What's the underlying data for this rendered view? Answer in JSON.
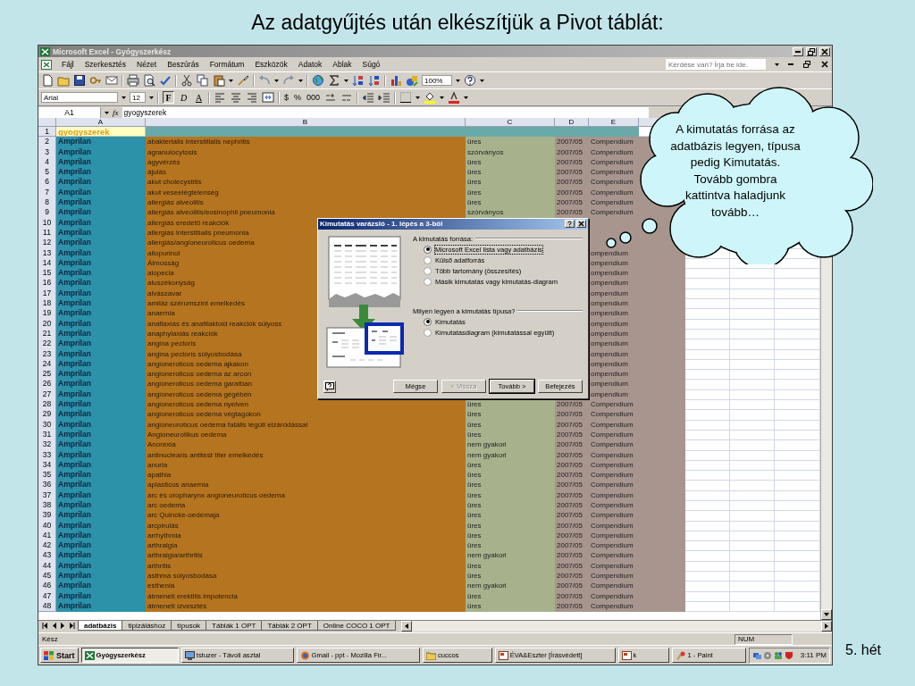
{
  "slide": {
    "title": "Az adatgyűjtés után elkészítjük a Pivot táblát:",
    "footer": "5. hét"
  },
  "window": {
    "title": "Microsoft Excel - Gyógyszerkész"
  },
  "menu": [
    "Fájl",
    "Szerkesztés",
    "Nézet",
    "Beszúrás",
    "Formátum",
    "Eszközök",
    "Adatok",
    "Ablak",
    "Súgó"
  ],
  "help_box": {
    "placeholder": "Kérdése van? Írja be ide."
  },
  "toolbar": {
    "zoom": "100%",
    "font": "Arial",
    "font_size": "12",
    "format_buttons": [
      {
        "label": "F",
        "kind": "bold"
      },
      {
        "label": "D",
        "kind": "italic"
      },
      {
        "label": "A",
        "kind": "underline"
      }
    ],
    "number_buttons": [
      "$",
      "%",
      "000"
    ]
  },
  "formula_bar": {
    "name_box": "A1",
    "function_label": "fx",
    "value": "gyogyszerek"
  },
  "sheet": {
    "columns": [
      "A",
      "B",
      "C",
      "D",
      "E"
    ],
    "rows": [
      {
        "kind": "header",
        "n": "1",
        "a": "gyogyszerek"
      },
      {
        "kind": "data",
        "n": "2",
        "a": "Amprilan",
        "b": "abakterialis interstitialis nephritis",
        "c": "üres",
        "d": "2007/05",
        "e": "Compendium"
      },
      {
        "kind": "data",
        "n": "3",
        "a": "Amprilan",
        "b": "agranulocytosis",
        "c": "szórványos",
        "d": "2007/05",
        "e": "Compendium"
      },
      {
        "kind": "data",
        "n": "4",
        "a": "Amprilan",
        "b": "agyvérzés",
        "c": "üres",
        "d": "2007/05",
        "e": "Compendium"
      },
      {
        "kind": "data",
        "n": "5",
        "a": "Amprilan",
        "b": "ájulás",
        "c": "üres",
        "d": "2007/05",
        "e": "Compendium"
      },
      {
        "kind": "data",
        "n": "6",
        "a": "Amprilan",
        "b": "akut cholecystitis",
        "c": "üres",
        "d": "2007/05",
        "e": "Compendium"
      },
      {
        "kind": "data",
        "n": "7",
        "a": "Amprilan",
        "b": "akut veseelégtelenség",
        "c": "üres",
        "d": "2007/05",
        "e": "Compendium"
      },
      {
        "kind": "data",
        "n": "8",
        "a": "Amprilan",
        "b": "allergiás alveolitis",
        "c": "üres",
        "d": "2007/05",
        "e": "Compendium"
      },
      {
        "kind": "data",
        "n": "9",
        "a": "Amprilan",
        "b": "allergiás alveolitis/eosinophil pneumonia",
        "c": "szórványos",
        "d": "2007/05",
        "e": "Compendium"
      },
      {
        "kind": "data",
        "n": "10",
        "a": "Amprilan",
        "b": "allergiás eredetű reakciók"
      },
      {
        "kind": "data",
        "n": "11",
        "a": "Amprilan",
        "b": "allergiás interstitialis pneumonia"
      },
      {
        "kind": "data",
        "n": "12",
        "a": "Amprilan",
        "b": "allergiás/angioneuroticus oedema"
      },
      {
        "kind": "data",
        "n": "13",
        "a": "Amprilan",
        "b": "allopurinol",
        "e": "ompendium"
      },
      {
        "kind": "data",
        "n": "14",
        "a": "Amprilan",
        "b": "Álmosság",
        "e": "ompendium"
      },
      {
        "kind": "data",
        "n": "15",
        "a": "Amprilan",
        "b": "alopecia",
        "e": "ompendium"
      },
      {
        "kind": "data",
        "n": "16",
        "a": "Amprilan",
        "b": "aluszékonyság",
        "e": "ompendium"
      },
      {
        "kind": "data",
        "n": "17",
        "a": "Amprilan",
        "b": "alvászavar",
        "e": "ompendium"
      },
      {
        "kind": "data",
        "n": "18",
        "a": "Amprilan",
        "b": "amiláz szérumszint emelkedés",
        "e": "ompendium"
      },
      {
        "kind": "data",
        "n": "19",
        "a": "Amprilan",
        "b": "anaemia",
        "e": "ompendium"
      },
      {
        "kind": "data",
        "n": "20",
        "a": "Amprilan",
        "b": "anafiaxiás és anafilaktoid reakciók súlyoss",
        "e": "ompendium"
      },
      {
        "kind": "data",
        "n": "21",
        "a": "Amprilan",
        "b": "anaphylaxiás reakciók",
        "e": "ompendium"
      },
      {
        "kind": "data",
        "n": "22",
        "a": "Amprilan",
        "b": "angina pectoris",
        "e": "ompendium"
      },
      {
        "kind": "data",
        "n": "23",
        "a": "Amprilan",
        "b": "angina pectoris súlyosbodása",
        "e": "ompendium"
      },
      {
        "kind": "data",
        "n": "24",
        "a": "Amprilan",
        "b": "angioneroticus oedema ajkakon",
        "e": "ompendium"
      },
      {
        "kind": "data",
        "n": "25",
        "a": "Amprilan",
        "b": "angioneroticus oedema az arcon",
        "e": "ompendium"
      },
      {
        "kind": "data",
        "n": "26",
        "a": "Amprilan",
        "b": "angioneroticus oedema garatban",
        "e": "ompendium"
      },
      {
        "kind": "data",
        "n": "27",
        "a": "Amprilan",
        "b": "angioneroticus oedema gégében",
        "e": "ompendium"
      },
      {
        "kind": "data",
        "n": "28",
        "a": "Amprilan",
        "b": "angioneroticus oedema nyelven",
        "c": "üres",
        "d": "2007/05",
        "e": "Compendium"
      },
      {
        "kind": "data",
        "n": "29",
        "a": "Amprilan",
        "b": "angioneroticus oedema végtagokon",
        "c": "üres",
        "d": "2007/05",
        "e": "Compendium"
      },
      {
        "kind": "data",
        "n": "30",
        "a": "Amprilan",
        "b": "angioneuroticus oedema fatális légúti elzáródással",
        "c": "üres",
        "d": "2007/05",
        "e": "Compendium"
      },
      {
        "kind": "data",
        "n": "31",
        "a": "Amprilan",
        "b": "Angioneurotikus oedema",
        "c": "üres",
        "d": "2007/05",
        "e": "Compendium"
      },
      {
        "kind": "data",
        "n": "32",
        "a": "Amprilan",
        "b": "Anorexia",
        "c": "nem gyakori",
        "d": "2007/05",
        "e": "Compendium"
      },
      {
        "kind": "data",
        "n": "33",
        "a": "Amprilan",
        "b": "antinuclearis antitest titer emelkedés",
        "c": "nem gyakori",
        "d": "2007/05",
        "e": "Compendium"
      },
      {
        "kind": "data",
        "n": "34",
        "a": "Amprilan",
        "b": "anuria",
        "c": "üres",
        "d": "2007/05",
        "e": "Compendium"
      },
      {
        "kind": "data",
        "n": "35",
        "a": "Amprilan",
        "b": "apathia",
        "c": "üres",
        "d": "2007/05",
        "e": "Compendium"
      },
      {
        "kind": "data",
        "n": "36",
        "a": "Amprilan",
        "b": "aplasticus anaemia",
        "c": "üres",
        "d": "2007/05",
        "e": "Compendium"
      },
      {
        "kind": "data",
        "n": "37",
        "a": "Amprilan",
        "b": "arc és oropharynx angioneuroticus oedema",
        "c": "üres",
        "d": "2007/05",
        "e": "Compendium"
      },
      {
        "kind": "data",
        "n": "38",
        "a": "Amprilan",
        "b": "arc oedema",
        "c": "üres",
        "d": "2007/05",
        "e": "Compendium"
      },
      {
        "kind": "data",
        "n": "39",
        "a": "Amprilan",
        "b": "arc Quincke-oedemaja",
        "c": "üres",
        "d": "2007/05",
        "e": "Compendium"
      },
      {
        "kind": "data",
        "n": "40",
        "a": "Amprilan",
        "b": "arcpirulás",
        "c": "üres",
        "d": "2007/05",
        "e": "Compendium"
      },
      {
        "kind": "data",
        "n": "41",
        "a": "Amprilan",
        "b": "arrhythmia",
        "c": "üres",
        "d": "2007/05",
        "e": "Compendium"
      },
      {
        "kind": "data",
        "n": "42",
        "a": "Amprilan",
        "b": "arthralgia",
        "c": "üres",
        "d": "2007/05",
        "e": "Compendium"
      },
      {
        "kind": "data",
        "n": "43",
        "a": "Amprilan",
        "b": "arthralgia/arthritis",
        "c": "nem gyakori",
        "d": "2007/05",
        "e": "Compendium"
      },
      {
        "kind": "data",
        "n": "44",
        "a": "Amprilan",
        "b": "arthritis",
        "c": "üres",
        "d": "2007/05",
        "e": "Compendium"
      },
      {
        "kind": "data",
        "n": "45",
        "a": "Amprilan",
        "b": "asthma súlyosbodása",
        "c": "üres",
        "d": "2007/05",
        "e": "Compendium"
      },
      {
        "kind": "data",
        "n": "46",
        "a": "Amprilan",
        "b": "esthenia",
        "c": "nem gyakori",
        "d": "2007/05",
        "e": "Compendium"
      },
      {
        "kind": "data",
        "n": "47",
        "a": "Amprilan",
        "b": "átmeneti erektilis impotencia",
        "c": "üres",
        "d": "2007/05",
        "e": "Compendium"
      },
      {
        "kind": "data",
        "n": "48",
        "a": "Amprilan",
        "b": "átmeneti ízvesztés",
        "c": "üres",
        "d": "2007/05",
        "e": "Compendium"
      }
    ]
  },
  "sheet_tabs": [
    {
      "label": "adatbázis",
      "selected": true
    },
    {
      "label": "tipizáláshoz",
      "selected": false
    },
    {
      "label": "típusok",
      "selected": false
    },
    {
      "label": "Táblák 1 OPT",
      "selected": false
    },
    {
      "label": "Táblák 2 OPT",
      "selected": false
    },
    {
      "label": "Online COCO 1 OPT",
      "selected": false
    }
  ],
  "status_bar": {
    "status": "Kész",
    "num": "NUM"
  },
  "dialog": {
    "title": "Kimutatás varázsló - 1. lépés a 3-ból",
    "source_label": "A kimutatás forrása:",
    "source_options": [
      {
        "label": "Microsoft Excel lista vagy adatbázis",
        "selected": true
      },
      {
        "label": "Külső adatforrás",
        "selected": false
      },
      {
        "label": "Több tartomány (összesítés)",
        "selected": false
      },
      {
        "label": "Másik kimutatás vagy kimutatás-diagram",
        "selected": false
      }
    ],
    "type_label": "Milyen legyen a kimutatás típusa?",
    "type_options": [
      {
        "label": "Kimutatás",
        "selected": true
      },
      {
        "label": "Kimutatásdiagram (kimutatással együtt)",
        "selected": false
      }
    ],
    "buttons": [
      {
        "label": "Mégse",
        "disabled": false,
        "default": false
      },
      {
        "label": "< Vissza",
        "disabled": true,
        "default": false
      },
      {
        "label": "Tovább >",
        "disabled": false,
        "default": true
      },
      {
        "label": "Befejezés",
        "disabled": false,
        "default": false
      }
    ]
  },
  "callout": {
    "text": "A kimutatás forrása az adatbázis legyen, típusa pedig Kimutatás. Tovább gombra kattintva haladjunk tovább…"
  },
  "taskbar": {
    "start": "Start",
    "tasks": [
      {
        "label": "Gyógyszerkész",
        "selected": true
      },
      {
        "label": "tstuzer - Távoli asztal",
        "selected": false
      },
      {
        "label": "Gmail - ppt - Mozilla Fir...",
        "selected": false
      },
      {
        "label": "cuccos",
        "selected": false
      },
      {
        "label": "ÉVA&Eszter [Írásvédett]",
        "selected": false
      },
      {
        "label": "k",
        "selected": false
      },
      {
        "label": "1 - Paint",
        "selected": false
      }
    ],
    "clock": "3:11 PM"
  }
}
